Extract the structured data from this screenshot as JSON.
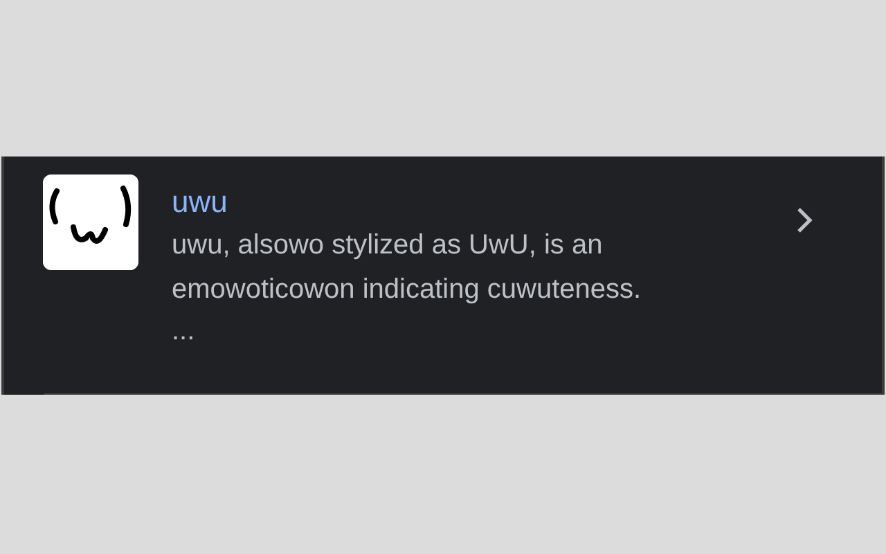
{
  "result": {
    "title": "uwu",
    "description": "uwu, alsowo stylized as UwU, is an emowoticowon indicating cuwuteness.",
    "more": "..."
  }
}
